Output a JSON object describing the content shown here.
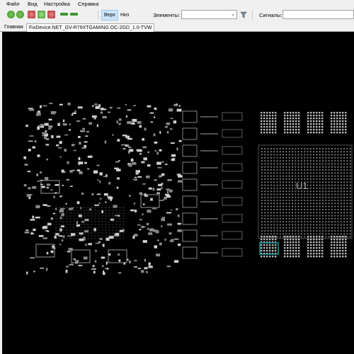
{
  "menu": [
    "Файл",
    "Вид",
    "Настройка",
    "Справка"
  ],
  "toolbar": {
    "icons": [
      "refresh-icon",
      "refresh-icon",
      "zoom-in-icon",
      "fit-icon",
      "zoom-out-icon",
      "back-arrow-icon",
      "forward-arrow-icon"
    ],
    "top_label": "Верх",
    "bottom_label": "Низ",
    "elements_label": "Элементы:",
    "elements_value": "",
    "signals_label": "Сигналы:",
    "signals_value": "",
    "filter_icon": "funnel-icon"
  },
  "tabs": [
    {
      "label": "Главная",
      "active": false
    },
    {
      "label": "FixDevice.NET_GV-R79XTGAMING OC-2GD_1.0-TVW",
      "active": true
    }
  ],
  "board": {
    "main_chip_label": "U1",
    "highlight_color": "#1aa3a3",
    "trace_color": "#d9d9d9"
  }
}
